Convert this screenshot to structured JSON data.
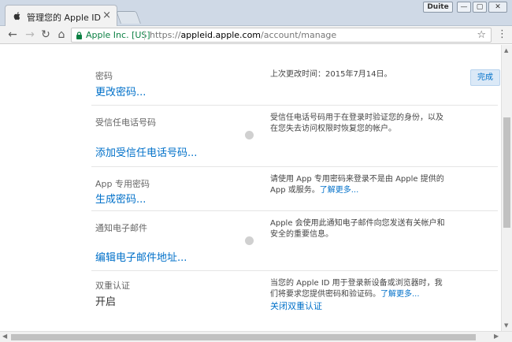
{
  "browser": {
    "tab_title": "管理您的 Apple ID",
    "tab_close": "×",
    "user_label": "Duite",
    "min_label": "—",
    "max_label": "▢",
    "close_label": "✕",
    "origin": "Apple Inc. [US]",
    "url_scheme": "https://",
    "url_host": "appleid.apple.com",
    "url_path": "/account/manage",
    "back_glyph": "←",
    "forward_glyph": "→",
    "reload_glyph": "↻",
    "home_glyph": "⌂",
    "star_glyph": "☆",
    "menu_glyph": "⋮"
  },
  "done_button": "完成",
  "rows": [
    {
      "label": "密码",
      "action": "更改密码...",
      "desc": "上次更改时间：2015年7月14日。"
    },
    {
      "label": "受信任电话号码",
      "action": "添加受信任电话号码...",
      "desc": "受信任电话号码用于在登录时验证您的身份，以及在您失去访问权限时恢复您的帐户。"
    },
    {
      "label": "App 专用密码",
      "action": "生成密码...",
      "desc": "请使用 App 专用密码来登录不是由 Apple 提供的 App 或服务。",
      "desc_link": "了解更多..."
    },
    {
      "label": "通知电子邮件",
      "action": "编辑电子邮件地址...",
      "desc": "Apple 会使用此通知电子邮件向您发送有关帐户和安全的重要信息。"
    },
    {
      "label": "双重认证",
      "value": "开启",
      "desc": "当您的 Apple ID 用于登录新设备或浏览器时，我们将要求您提供密码和验证码。",
      "desc_link": "了解更多...",
      "extra_link": "关闭双重认证"
    }
  ],
  "scroll": {
    "up": "▲",
    "down": "▼",
    "left": "◀",
    "right": "▶"
  }
}
